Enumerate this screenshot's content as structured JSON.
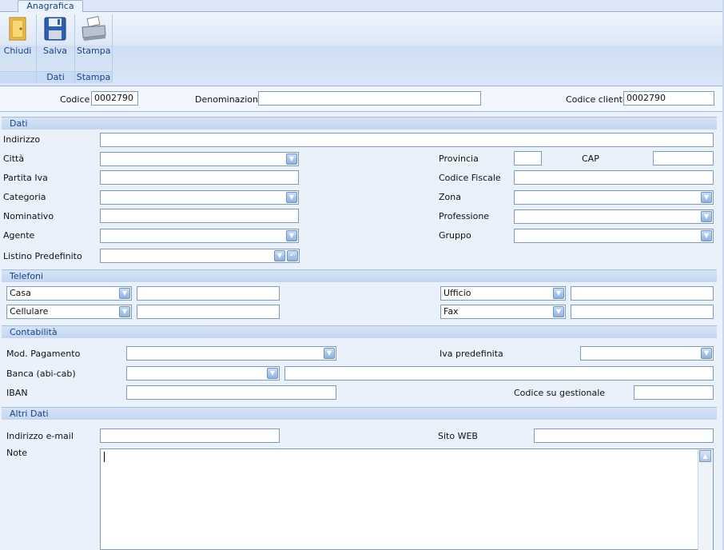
{
  "ribbon": {
    "tab": "Anagrafica",
    "buttons": {
      "close": "Chiudi",
      "save": "Salva",
      "print": "Stampa"
    },
    "groups": {
      "data": "Dati",
      "print": "Stampa"
    }
  },
  "header": {
    "code_label": "Codice",
    "code_value": "0002790",
    "name_label": "Denominazione",
    "name_value": "",
    "client_code_label": "Codice cliente",
    "client_code_value": "0002790"
  },
  "dati": {
    "title": "Dati",
    "address": "Indirizzo",
    "city": "Città",
    "province": "Provincia",
    "cap": "CAP",
    "vat": "Partita Iva",
    "tax_code": "Codice Fiscale",
    "category": "Categoria",
    "zone": "Zona",
    "nominative": "Nominativo",
    "profession": "Professione",
    "agent": "Agente",
    "group": "Gruppo",
    "price_list": "Listino Predefinito"
  },
  "telefoni": {
    "title": "Telefoni",
    "home": "Casa",
    "mobile": "Cellulare",
    "office": "Ufficio",
    "fax": "Fax"
  },
  "contabilita": {
    "title": "Contabilità",
    "payment": "Mod. Pagamento",
    "default_vat": "Iva predefinita",
    "bank": "Banca (abi-cab)",
    "iban": "IBAN",
    "mgmt_code": "Codice su gestionale"
  },
  "altri": {
    "title": "Altri Dati",
    "email": "Indirizzo e-mail",
    "web": "Sito WEB",
    "notes": "Note"
  },
  "colors": {
    "accent": "#15428b",
    "border": "#7f9db9",
    "ribbon": "#dbe7f7"
  }
}
